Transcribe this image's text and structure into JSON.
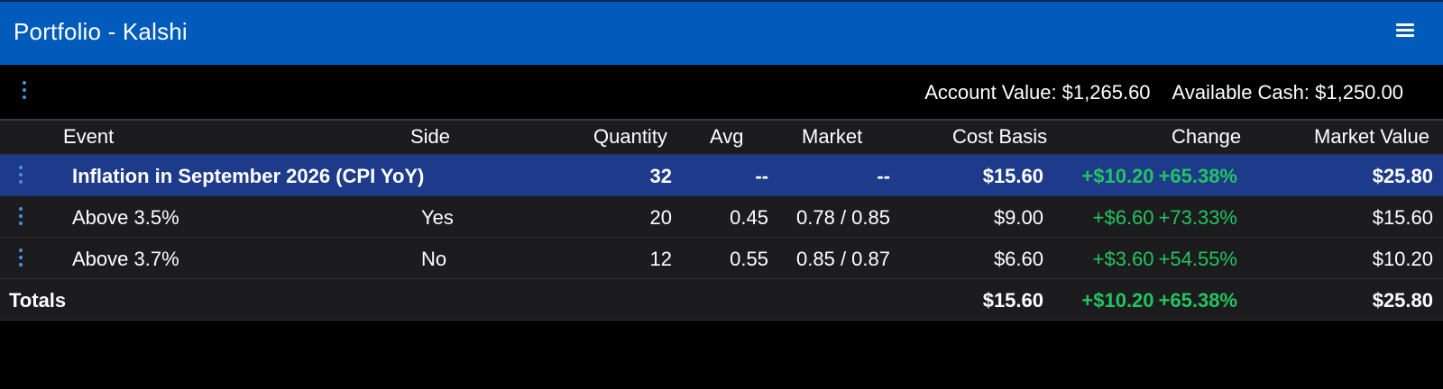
{
  "header": {
    "title": "Portfolio - Kalshi",
    "menu_icon": "hamburger-menu-icon"
  },
  "summary": {
    "account_value_label": "Account Value: $1,265.60",
    "available_cash_label": "Available Cash: $1,250.00"
  },
  "columns": {
    "event": "Event",
    "side": "Side",
    "quantity": "Quantity",
    "avg": "Avg",
    "market": "Market",
    "cost_basis": "Cost Basis",
    "change": "Change",
    "market_value": "Market Value"
  },
  "group": {
    "event": "Inflation in September 2026 (CPI YoY)",
    "quantity": "32",
    "avg": "--",
    "market": "--",
    "cost_basis": "$15.60",
    "change_amount": "+$10.20",
    "change_pct": "+65.38%",
    "market_value": "$25.80"
  },
  "positions": [
    {
      "event": "Above 3.5%",
      "side": "Yes",
      "quantity": "20",
      "avg": "0.45",
      "market": "0.78 / 0.85",
      "cost_basis": "$9.00",
      "change_amount": "+$6.60",
      "change_pct": "+73.33%",
      "market_value": "$15.60"
    },
    {
      "event": "Above 3.7%",
      "side": "No",
      "quantity": "12",
      "avg": "0.55",
      "market": "0.85 / 0.87",
      "cost_basis": "$6.60",
      "change_amount": "+$3.60",
      "change_pct": "+54.55%",
      "market_value": "$10.20"
    }
  ],
  "totals": {
    "label": "Totals",
    "cost_basis": "$15.60",
    "change_amount": "+$10.20",
    "change_pct": "+65.38%",
    "market_value": "$25.80"
  },
  "colors": {
    "header_bg": "#005bbb",
    "group_row_bg": "#1e3a8a",
    "row_bg": "#1c1c1e",
    "positive": "#22c55e",
    "kebab": "#4a90e2"
  }
}
